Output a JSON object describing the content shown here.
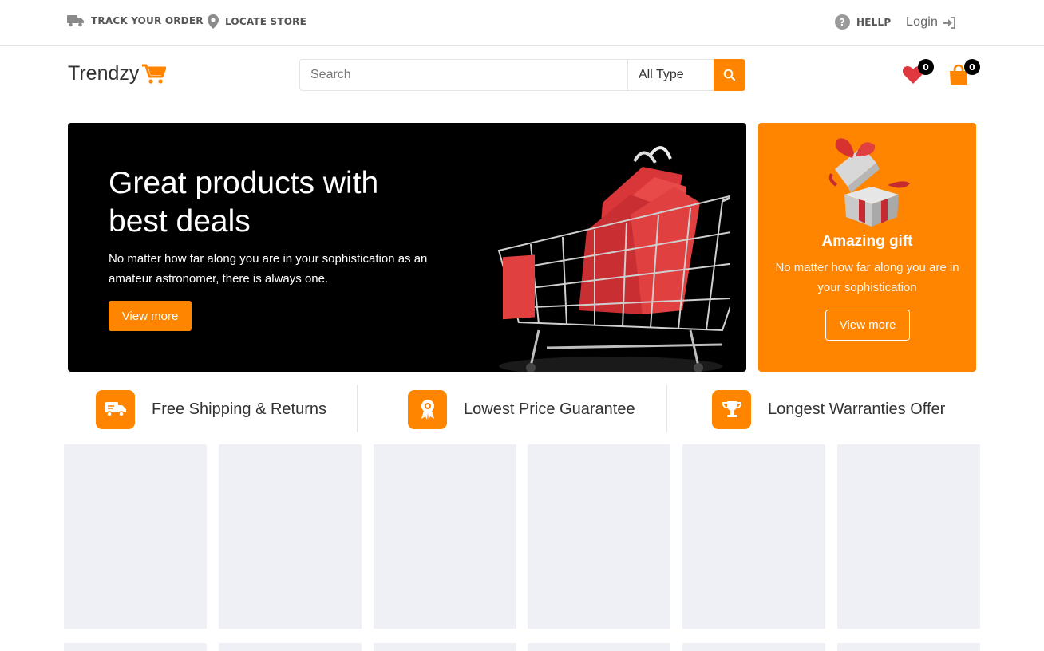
{
  "topbar": {
    "track_order": "TRACK YOUR ORDER",
    "locate_store": "LOCATE STORE",
    "help": "HELLP",
    "login": "Login"
  },
  "header": {
    "brand": "Trendzy",
    "search_placeholder": "Search",
    "search_type": "All Type",
    "wishlist_count": "0",
    "cart_count": "0"
  },
  "hero": {
    "title": "Great products with best deals",
    "text": "No matter how far along you are in your sophistication as an amateur astronomer, there is always one.",
    "button": "View more"
  },
  "gift": {
    "title": "Amazing gift",
    "text": "No matter how far along you are in your sophistication",
    "button": "View more"
  },
  "features": [
    {
      "label": "Free Shipping & Returns",
      "icon": "truck-icon"
    },
    {
      "label": "Lowest Price Guarantee",
      "icon": "award-icon"
    },
    {
      "label": "Longest Warranties Offer",
      "icon": "trophy-icon"
    }
  ],
  "colors": {
    "accent": "#ff8400",
    "hero_bg": "#000000",
    "placeholder_bg": "#eff0f5",
    "wishlist_heart": "#e0383e"
  }
}
